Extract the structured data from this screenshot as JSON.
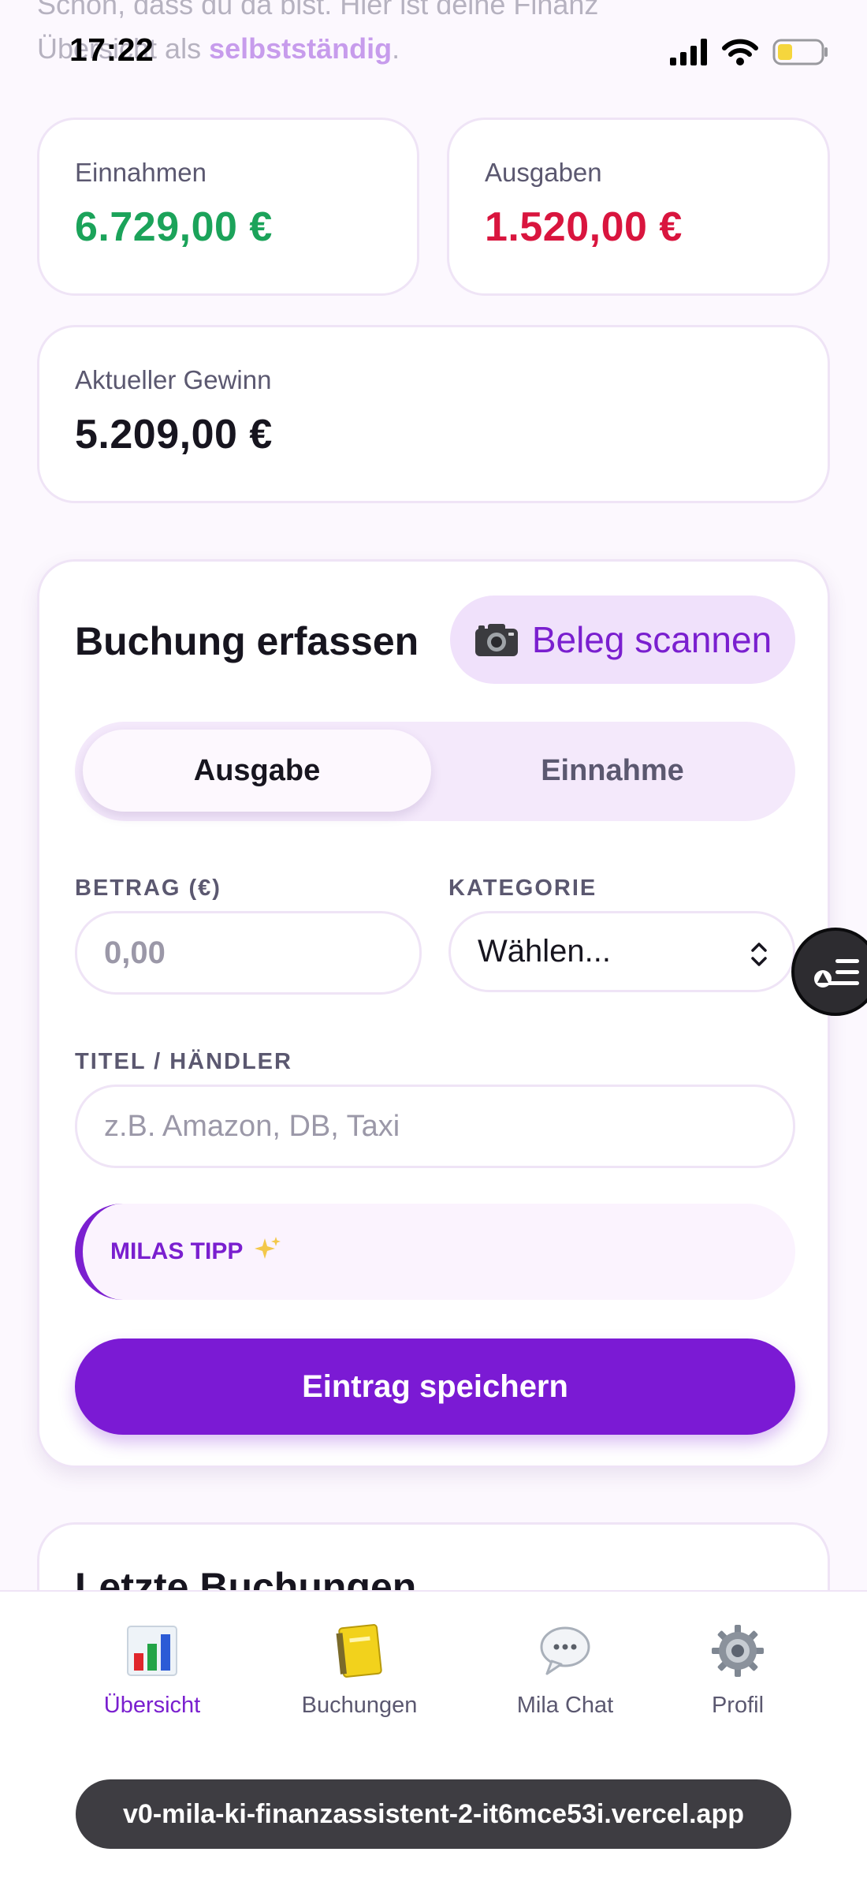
{
  "status_bar": {
    "time": "17:22"
  },
  "intro": {
    "line1": "Schön, dass du da bist. Hier ist deine Finanz",
    "line2_prefix": "Übersicht als ",
    "role": "selbstständig",
    "line2_suffix": "."
  },
  "summary": {
    "income_label": "Einnahmen",
    "income_value": "6.729,00 €",
    "expense_label": "Ausgaben",
    "expense_value": "1.520,00 €",
    "profit_label": "Aktueller Gewinn",
    "profit_value": "5.209,00 €"
  },
  "booking_form": {
    "title": "Buchung erfassen",
    "scan_icon": "camera-icon",
    "scan_label": "Beleg scannen",
    "type_options": [
      "Ausgabe",
      "Einnahme"
    ],
    "selected_type": "Ausgabe",
    "amount_label": "BETRAG (€)",
    "amount_placeholder": "0,00",
    "category_label": "KATEGORIE",
    "category_value": "Wählen...",
    "title_label": "TITEL / HÄNDLER",
    "title_placeholder": "z.B. Amazon, DB, Taxi",
    "tip_label": "MILAS TIPP",
    "tip_icon": "sparkles-icon",
    "save_label": "Eintrag speichern"
  },
  "recent": {
    "title": "Letzte Buchungen"
  },
  "bottom_nav": [
    {
      "label": "Übersicht",
      "icon": "bar-chart-icon",
      "active": true
    },
    {
      "label": "Buchungen",
      "icon": "notebook-icon",
      "active": false
    },
    {
      "label": "Mila Chat",
      "icon": "speech-bubble-icon",
      "active": false
    },
    {
      "label": "Profil",
      "icon": "gear-icon",
      "active": false
    }
  ],
  "browser": {
    "url": "v0-mila-ki-finanzassistent-2-it6mce53i.vercel.app"
  },
  "colors": {
    "accent": "#7b1ad4",
    "income": "#1ba35a",
    "expense": "#d9153e",
    "text": "#17151f",
    "muted": "#5b5870"
  }
}
